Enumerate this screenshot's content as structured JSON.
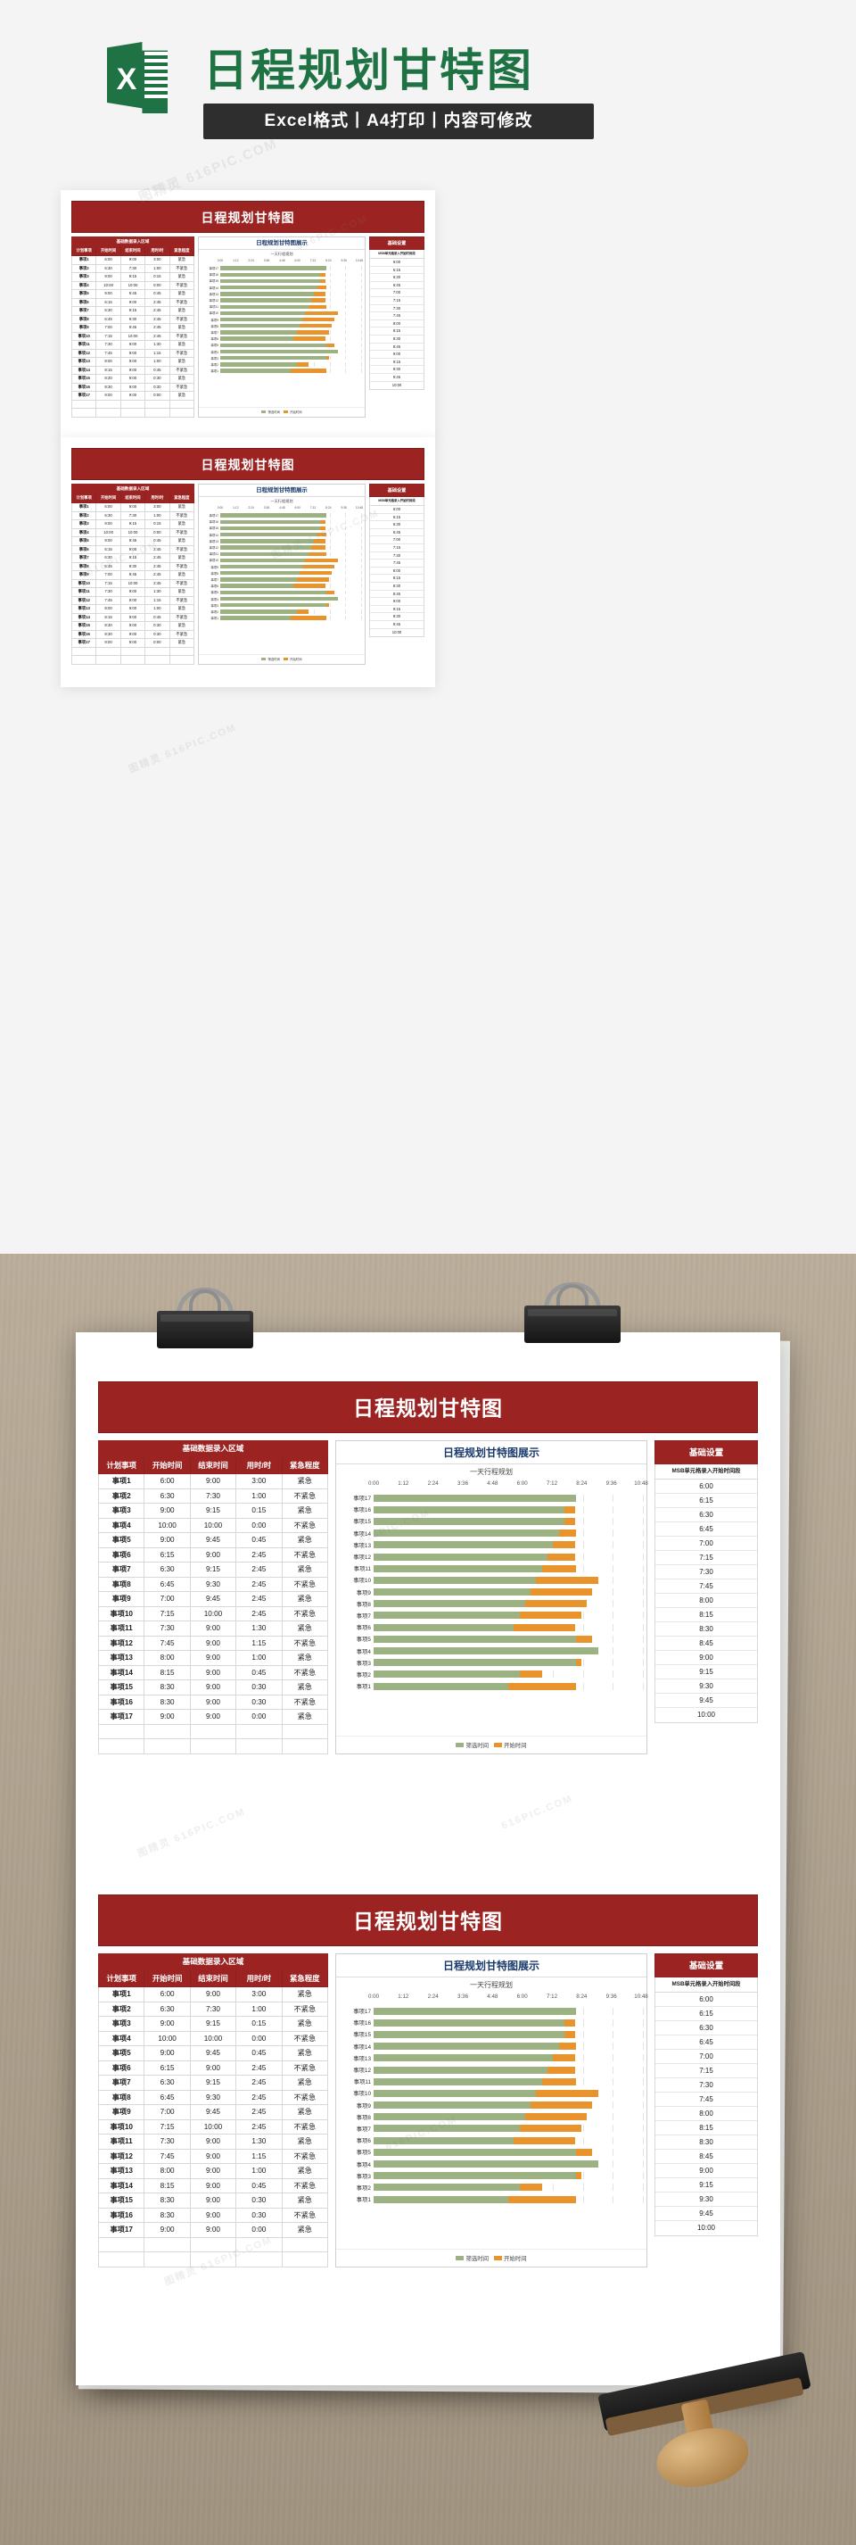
{
  "masthead": {
    "logo_letter": "X",
    "title": "日程规划甘特图",
    "subtitle": "Excel格式丨A4打印丨内容可修改"
  },
  "document": {
    "banner_title": "日程规划甘特图",
    "table": {
      "group_header": "基础数据录入区域",
      "columns": [
        "计划事项",
        "开始时间",
        "结束时间",
        "用时/时",
        "紧急程度"
      ],
      "rows": [
        [
          "事项1",
          "6:00",
          "9:00",
          "3:00",
          "紧急"
        ],
        [
          "事项2",
          "6:30",
          "7:30",
          "1:00",
          "不紧急"
        ],
        [
          "事项3",
          "9:00",
          "9:15",
          "0:15",
          "紧急"
        ],
        [
          "事项4",
          "10:00",
          "10:00",
          "0:00",
          "不紧急"
        ],
        [
          "事项5",
          "9:00",
          "9:45",
          "0:45",
          "紧急"
        ],
        [
          "事项6",
          "6:15",
          "9:00",
          "2:45",
          "不紧急"
        ],
        [
          "事项7",
          "6:30",
          "9:15",
          "2:45",
          "紧急"
        ],
        [
          "事项8",
          "6:45",
          "9:30",
          "2:45",
          "不紧急"
        ],
        [
          "事项9",
          "7:00",
          "9:45",
          "2:45",
          "紧急"
        ],
        [
          "事项10",
          "7:15",
          "10:00",
          "2:45",
          "不紧急"
        ],
        [
          "事项11",
          "7:30",
          "9:00",
          "1:30",
          "紧急"
        ],
        [
          "事项12",
          "7:45",
          "9:00",
          "1:15",
          "不紧急"
        ],
        [
          "事项13",
          "8:00",
          "9:00",
          "1:00",
          "紧急"
        ],
        [
          "事项14",
          "8:15",
          "9:00",
          "0:45",
          "不紧急"
        ],
        [
          "事项15",
          "8:30",
          "9:00",
          "0:30",
          "紧急"
        ],
        [
          "事项16",
          "8:30",
          "9:00",
          "0:30",
          "不紧急"
        ],
        [
          "事项17",
          "9:00",
          "9:00",
          "0:00",
          "紧急"
        ]
      ]
    },
    "chart_panel": {
      "title": "日程规划甘特图展示",
      "subtitle": "一天行程规划",
      "legend": [
        {
          "label": "筛选时间",
          "color": "#9cb283"
        },
        {
          "label": "开始时间",
          "color": "#e8932c"
        }
      ]
    },
    "settings": {
      "title": "基础设置",
      "note": "MSB单元格录入开始时间段",
      "times": [
        "6:00",
        "6:15",
        "6:30",
        "6:45",
        "7:00",
        "7:15",
        "7:30",
        "7:45",
        "8:00",
        "8:15",
        "8:30",
        "8:45",
        "9:00",
        "9:15",
        "9:30",
        "9:45",
        "10:00"
      ]
    }
  },
  "chart_data": {
    "type": "bar",
    "orientation": "horizontal",
    "title": "日程规划甘特图展示",
    "subtitle": "一天行程规划",
    "xlabel": "",
    "ylabel": "",
    "xlim": [
      0,
      0.45
    ],
    "x_ticks": [
      "0:00",
      "1:12",
      "2:24",
      "3:36",
      "4:48",
      "6:00",
      "7:12",
      "8:24",
      "9:36",
      "10:48"
    ],
    "categories": [
      "事项17",
      "事项16",
      "事项15",
      "事项14",
      "事项13",
      "事项12",
      "事项11",
      "事项10",
      "事项9",
      "事项8",
      "事项7",
      "事项6",
      "事项5",
      "事项4",
      "事项3",
      "事项2",
      "事项1"
    ],
    "series": [
      {
        "name": "筛选时间",
        "color": "#9cb283",
        "values": [
          9.0,
          8.5,
          8.5,
          8.25,
          8.0,
          7.75,
          7.5,
          7.25,
          7.0,
          6.75,
          6.5,
          6.25,
          9.0,
          10.0,
          9.0,
          6.5,
          6.0
        ]
      },
      {
        "name": "开始时间",
        "color": "#e8932c",
        "values": [
          0.0,
          0.5,
          0.5,
          0.75,
          1.0,
          1.25,
          1.5,
          2.75,
          2.75,
          2.75,
          2.75,
          2.75,
          0.75,
          0.0,
          0.25,
          1.0,
          3.0
        ]
      }
    ],
    "grid": true,
    "legend_position": "bottom"
  },
  "watermarks": {
    "text_a": "图精灵 616PIC.COM",
    "text_b": "616PIC.COM"
  }
}
